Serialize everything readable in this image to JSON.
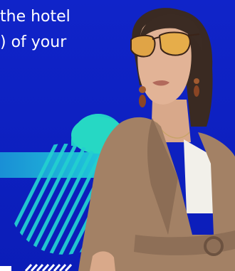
{
  "hero": {
    "headline_lines": [
      "the hotel",
      ") of your"
    ]
  },
  "colors": {
    "background": "#0d1fc4",
    "accent_teal": "#22d3c1",
    "accent_cyan": "#1fb8e0",
    "stripe_teal": "#2bd4c4"
  },
  "person": {
    "accessory_icon": "sunglasses-icon"
  }
}
